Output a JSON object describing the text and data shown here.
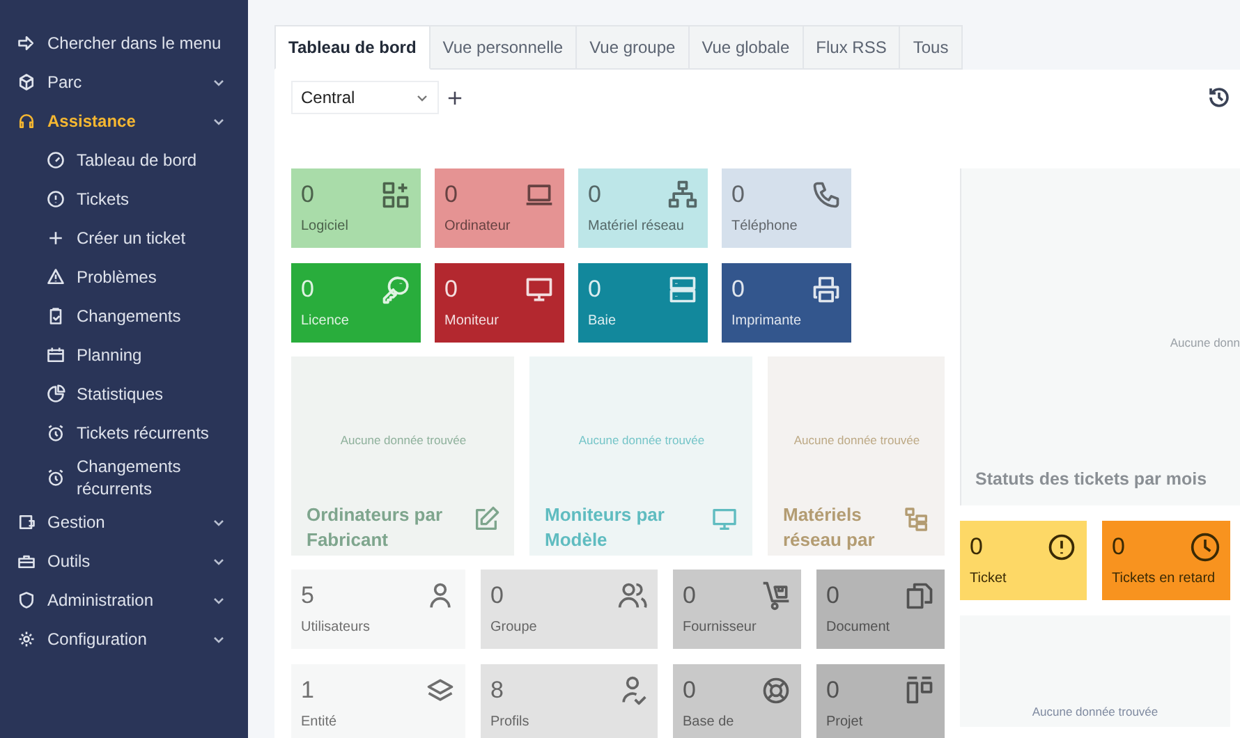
{
  "sidebar": {
    "search_label": "Chercher dans le menu",
    "sections": [
      {
        "label": "Parc",
        "selected": false
      },
      {
        "label": "Assistance",
        "selected": true,
        "children": [
          {
            "label": "Tableau de bord"
          },
          {
            "label": "Tickets"
          },
          {
            "label": "Créer un ticket"
          },
          {
            "label": "Problèmes"
          },
          {
            "label": "Changements"
          },
          {
            "label": "Planning"
          },
          {
            "label": "Statistiques"
          },
          {
            "label": "Tickets récurrents"
          },
          {
            "label": "Changements récurrents"
          }
        ]
      },
      {
        "label": "Gestion",
        "selected": false
      },
      {
        "label": "Outils",
        "selected": false
      },
      {
        "label": "Administration",
        "selected": false
      },
      {
        "label": "Configuration",
        "selected": false
      }
    ]
  },
  "tabs": [
    {
      "label": "Tableau de bord",
      "selected": true
    },
    {
      "label": "Vue personnelle",
      "selected": false
    },
    {
      "label": "Vue groupe",
      "selected": false
    },
    {
      "label": "Vue globale",
      "selected": false
    },
    {
      "label": "Flux RSS",
      "selected": false
    },
    {
      "label": "Tous",
      "selected": false
    }
  ],
  "dashboard_select": {
    "value": "Central"
  },
  "asset_tiles": [
    {
      "value": "0",
      "label": "Logiciel",
      "color": "#a9dca9"
    },
    {
      "value": "0",
      "label": "Ordinateur",
      "color": "#e59393"
    },
    {
      "value": "0",
      "label": "Matériel réseau",
      "color": "#bde6e8"
    },
    {
      "value": "0",
      "label": "Téléphone",
      "color": "#d5e0ec"
    },
    {
      "value": "0",
      "label": "Licence",
      "color": "#29ad3c"
    },
    {
      "value": "0",
      "label": "Moniteur",
      "color": "#b3282f"
    },
    {
      "value": "0",
      "label": "Baie",
      "color": "#12889c"
    },
    {
      "value": "0",
      "label": "Imprimante",
      "color": "#33568d"
    }
  ],
  "chart_cards": [
    {
      "title": "Ordinateurs par Fabricant",
      "message": "Aucune donnée trouvée",
      "color": "#7ea58d"
    },
    {
      "title": "Moniteurs par Modèle",
      "message": "Aucune donnée trouvée",
      "color": "#5fbcc0"
    },
    {
      "title": "Matériels réseau par",
      "message": "Aucune donnée trouvée",
      "color": "#b39c72"
    }
  ],
  "status_card": {
    "title": "Statuts des tickets par mois",
    "message": "Aucune donn"
  },
  "ticket_tiles": [
    {
      "value": "0",
      "label": "Ticket",
      "color": "#fdd866"
    },
    {
      "value": "0",
      "label": "Tickets en retard",
      "color": "#f8931f"
    }
  ],
  "bottom_card": {
    "message": "Aucune donnée trouvée"
  },
  "admin_tiles": [
    {
      "value": "5",
      "label": "Utilisateurs",
      "color": "#f6f7f7"
    },
    {
      "value": "0",
      "label": "Groupe",
      "color": "#e2e2e2"
    },
    {
      "value": "0",
      "label": "Fournisseur",
      "color": "#c9c9c9"
    },
    {
      "value": "0",
      "label": "Document",
      "color": "#b5b5b5"
    },
    {
      "value": "1",
      "label": "Entité",
      "color": "#f6f7f7"
    },
    {
      "value": "8",
      "label": "Profils",
      "color": "#e2e2e2"
    },
    {
      "value": "0",
      "label": "Base de",
      "color": "#c9c9c9"
    },
    {
      "value": "0",
      "label": "Projet",
      "color": "#b5b5b5"
    }
  ]
}
